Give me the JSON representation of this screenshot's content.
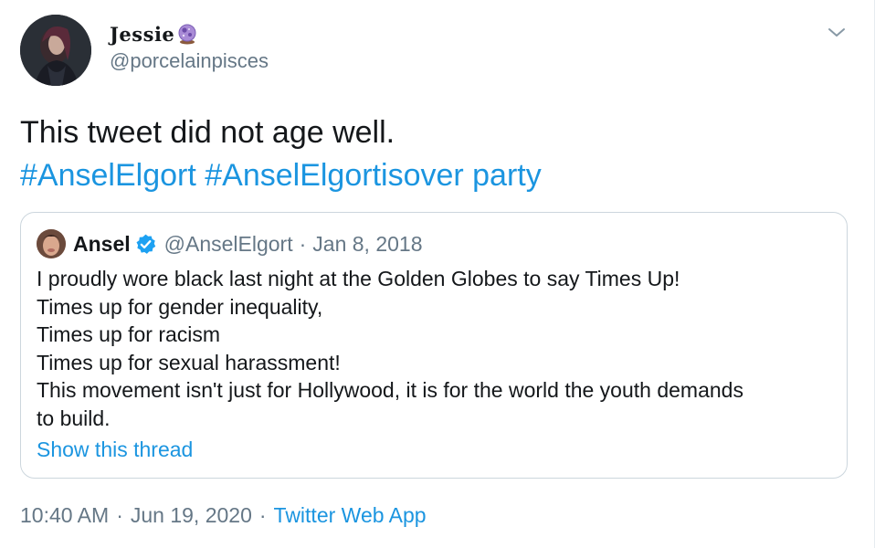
{
  "author": {
    "display_name": "Jessie",
    "handle": "@porcelainpisces",
    "name_emoji_icon": "crystal-ball-icon",
    "avatar_icon": "profile-photo"
  },
  "menu_icon": "chevron-down-icon",
  "tweet": {
    "text": "This tweet did not age well.",
    "hashtags": [
      "#AnselElgort",
      "#AnselElgortisover party"
    ]
  },
  "quoted_tweet": {
    "display_name": "Ansel",
    "verified_icon": "verified-badge-icon",
    "handle": "@AnselElgort",
    "separator": "·",
    "date": "Jan 8, 2018",
    "lines": [
      "I proudly wore black last night at the Golden Globes to say Times Up!",
      "Times up for gender inequality,",
      "Times up for racism",
      "Times up for sexual harassment!",
      "This movement isn't just for Hollywood, it is for the world the youth demands",
      "to build."
    ],
    "show_thread_label": "Show this thread"
  },
  "meta": {
    "time": "10:40 AM",
    "separator": "·",
    "date": "Jun 19, 2020",
    "source": "Twitter Web App"
  },
  "colors": {
    "link": "#1b95e0",
    "secondary_text": "#657786",
    "primary_text": "#14171a",
    "border": "#ccd6dd",
    "verified": "#1da1f2"
  }
}
